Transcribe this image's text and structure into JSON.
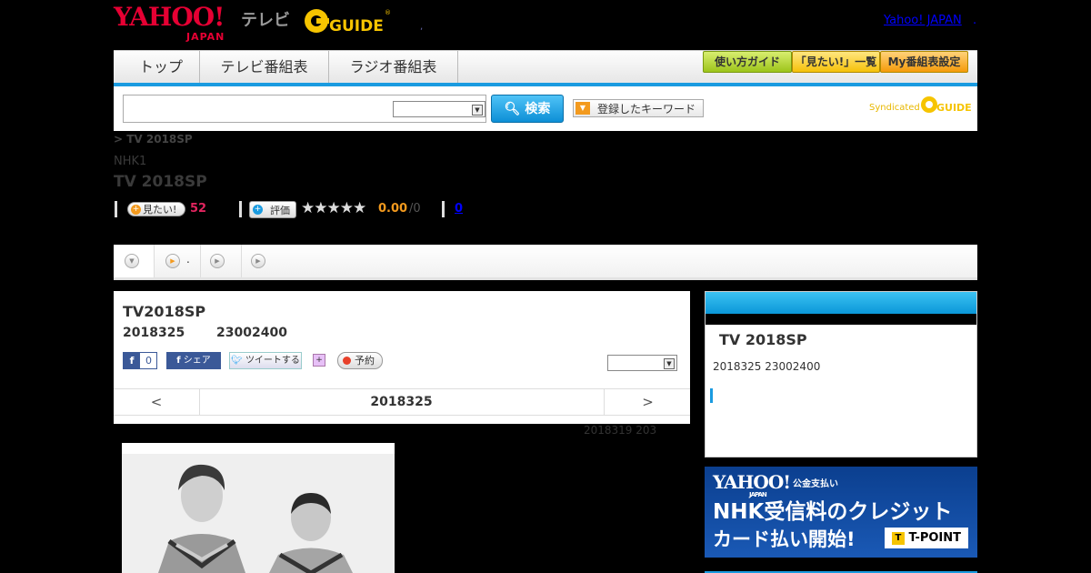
{
  "header": {
    "yahoo_logo": "YAHOO!",
    "yahoo_logo_sub": "JAPAN",
    "tv_label": "テレビ",
    "gguide_logo": "GUIDE",
    "dot": ",",
    "yahoo_japan_link": "Yahoo! JAPAN",
    "yahoo_japan_link_tail": "."
  },
  "nav": {
    "tabs": [
      "トップ",
      "テレビ番組表",
      "ラジオ番組表"
    ],
    "buttons": [
      "使い方ガイド",
      "「見たい!」一覧",
      "My番組表設定"
    ]
  },
  "search": {
    "input_value": "",
    "select_value": "",
    "button_label": "検索",
    "keyword_button": "登録したキーワード",
    "syndicated_label": "Syndicated",
    "syndicated_logo": "GUIDE"
  },
  "program": {
    "breadcrumb": "> TV 2018SP",
    "channel": "NHK1",
    "title": "TV 2018SP",
    "mitai_label": "見たい!",
    "mitai_count": "52",
    "hyoka_label": "評価",
    "stars": "★★★★★",
    "score": "0.00",
    "score_max": "/0",
    "comment_count": "0"
  },
  "tabs_bar": {
    "tab2_label": "."
  },
  "detail": {
    "title": "TV2018SP",
    "date": "2018325",
    "time": "23002400",
    "fb_count": "0",
    "fb_share": "シェア",
    "tweet": "ツイートする",
    "reserve": "予約",
    "select_value": "",
    "prev": "<",
    "current_date": "2018325",
    "next": ">",
    "updated": "2018319  203"
  },
  "sidebar": {
    "title": "TV 2018SP",
    "date": "2018325  23002400"
  },
  "ad": {
    "yahoo": "YAHOO!",
    "yahoo_sub": "JAPAN",
    "kouki": "公金支払い",
    "line1": "NHK受信料のクレジット",
    "line2": "カード払い開始!",
    "tpoint": "T-POINT"
  },
  "colors": {
    "accent_blue": "#1a9be0",
    "yahoo_red": "#e60033",
    "gguide_yellow": "#f6c400",
    "mitai_pink": "#e0245e",
    "score_orange": "#f39a1e"
  }
}
